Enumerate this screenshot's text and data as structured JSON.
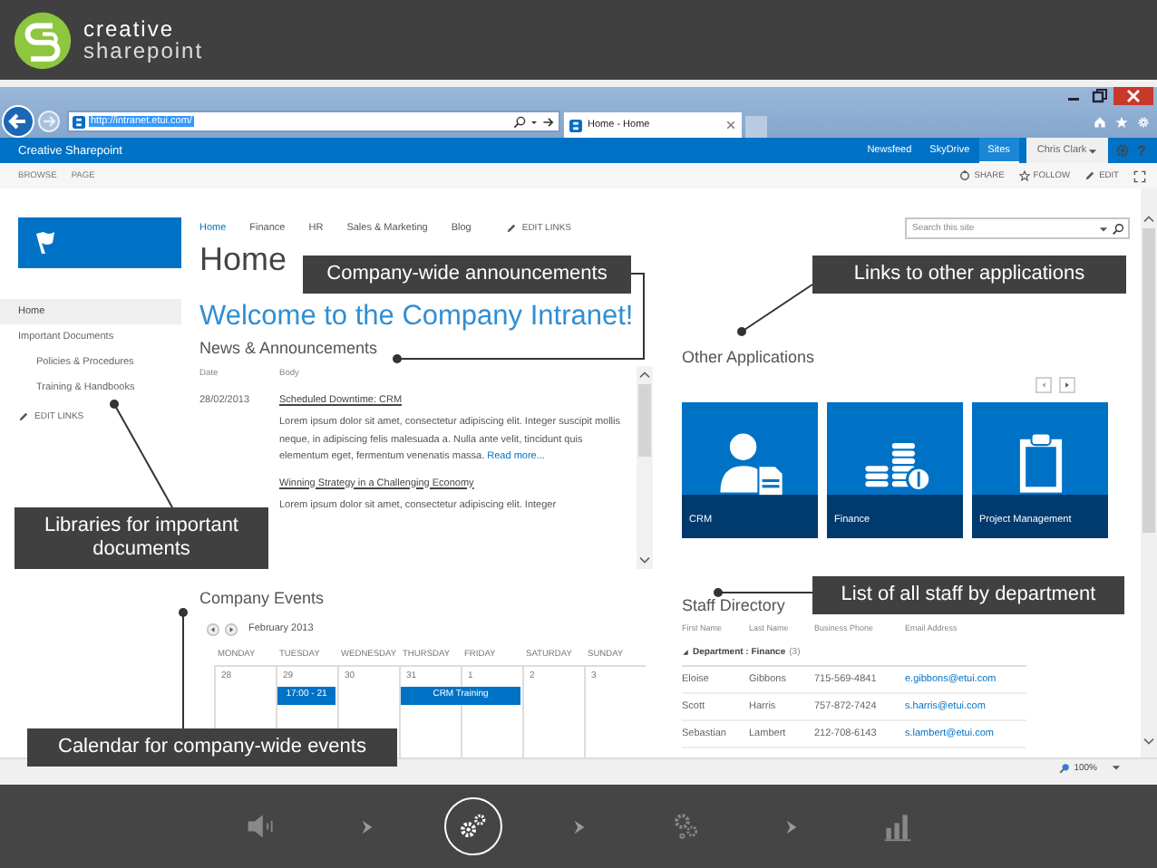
{
  "brand": {
    "line1": "creative",
    "line2": "sharepoint"
  },
  "browser": {
    "address": {
      "value": "http://intranet.etui.com/",
      "selected": true
    },
    "tab": "Home - Home"
  },
  "suite_bar": {
    "title": "Creative Sharepoint",
    "links": [
      {
        "label": "Newsfeed",
        "selected": false
      },
      {
        "label": "SkyDrive",
        "selected": false
      },
      {
        "label": "Sites",
        "selected": true
      }
    ],
    "user": "Chris Clark",
    "help": "?"
  },
  "ribbon": {
    "tabs": [
      "BROWSE",
      "PAGE"
    ],
    "actions": [
      {
        "label": "SHARE",
        "kind": "share"
      },
      {
        "label": "FOLLOW",
        "kind": "follow"
      },
      {
        "label": "EDIT",
        "kind": "edit"
      }
    ]
  },
  "left_nav": {
    "items": [
      {
        "label": "Home",
        "selected": true
      },
      {
        "label": "Important Documents",
        "selected": false,
        "children": [
          {
            "label": "Policies & Procedures"
          },
          {
            "label": "Training & Handbooks"
          }
        ]
      }
    ],
    "edit_links": "EDIT LINKS"
  },
  "top_nav": {
    "items": [
      {
        "label": "Home",
        "selected": true
      },
      {
        "label": "Finance",
        "selected": false
      },
      {
        "label": "HR",
        "selected": false
      },
      {
        "label": "Sales & Marketing",
        "selected": false
      },
      {
        "label": "Blog",
        "selected": false
      }
    ],
    "edit_links": "EDIT LINKS"
  },
  "search": {
    "placeholder": "Search this site"
  },
  "page_title": "Home",
  "welcome": "Welcome to the Company Intranet!",
  "news": {
    "title": "News & Announcements",
    "columns": [
      "Date",
      "Body"
    ],
    "items": [
      {
        "date": "28/02/2013",
        "title": "Scheduled Downtime: CRM",
        "body": "Lorem ipsum dolor sit amet, consectetur adipiscing elit. Integer suscipit mollis neque, in adipiscing felis malesuada a. Nulla ante velit, tincidunt quis elementum eget, fermentum venenatis massa.",
        "more": "Read more..."
      },
      {
        "title": "Winning Strategy in a Challenging Economy",
        "body": "Lorem ipsum dolor sit amet, consectetur adipiscing elit. Integer"
      }
    ]
  },
  "events": {
    "title": "Company Events",
    "month": "February 2013",
    "days": [
      "MONDAY",
      "TUESDAY",
      "WEDNESDAY",
      "THURSDAY",
      "FRIDAY",
      "SATURDAY",
      "SUNDAY"
    ],
    "dates": [
      "28",
      "29",
      "30",
      "31",
      "1",
      "2",
      "3"
    ],
    "entries": [
      {
        "label": "17:00 - 21"
      },
      {
        "label": "CRM Training"
      }
    ]
  },
  "apps": {
    "title": "Other Applications",
    "tiles": [
      {
        "label": "CRM",
        "kind": "crm"
      },
      {
        "label": "Finance",
        "kind": "finance"
      },
      {
        "label": "Project Management",
        "kind": "project"
      }
    ]
  },
  "staff": {
    "title": "Staff Directory",
    "columns": [
      "First Name",
      "Last Name",
      "Business Phone",
      "Email Address"
    ],
    "group": "Department : Finance",
    "count": "(3)",
    "rows": [
      [
        "Eloise",
        "Gibbons",
        "715-569-4841",
        "e.gibbons@etui.com"
      ],
      [
        "Scott",
        "Harris",
        "757-872-7424",
        "s.harris@etui.com"
      ],
      [
        "Sebastian",
        "Lambert",
        "212-708-6143",
        "s.lambert@etui.com"
      ]
    ]
  },
  "status_bar": {
    "zoom": "100%"
  },
  "callouts": [
    {
      "text": "Company-wide announcements"
    },
    {
      "text": "Links to other applications"
    },
    {
      "text": "Libraries for important documents"
    },
    {
      "text": "List of all staff by department"
    },
    {
      "text": "Calendar for company-wide events"
    }
  ],
  "player": {
    "steps": [
      {
        "kind": "audio",
        "selected": false
      },
      {
        "kind": "gears",
        "selected": true
      },
      {
        "kind": "cogs",
        "selected": false
      },
      {
        "kind": "chart",
        "selected": false
      }
    ]
  }
}
